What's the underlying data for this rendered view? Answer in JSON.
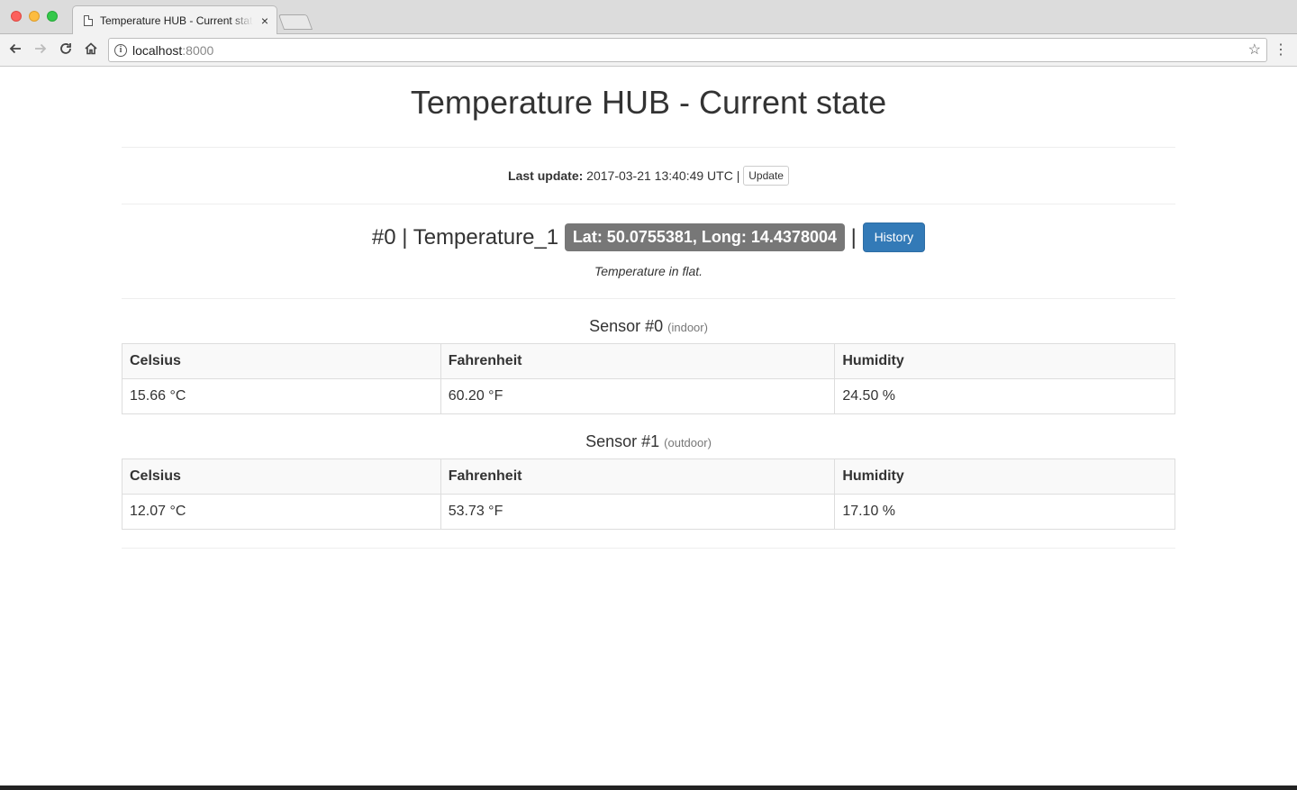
{
  "browser": {
    "tab_title": "Temperature HUB - Current state",
    "tab_close": "×",
    "url_host": "localhost",
    "url_port": ":8000",
    "icons": [
      "back-icon",
      "forward-icon",
      "reload-icon",
      "home-icon",
      "info-icon",
      "star-icon",
      "menu-icon"
    ]
  },
  "page": {
    "title": "Temperature HUB - Current state",
    "last_update_label": "Last update:",
    "last_update_value": "2017-03-21 13:40:49 UTC |",
    "update_button": "Update"
  },
  "device": {
    "heading": "#0 | Temperature_1",
    "location_label": "Lat: 50.0755381, Long: 14.4378004",
    "separator": "|",
    "history_button": "History",
    "description": "Temperature in flat.",
    "colors": {
      "label": "#777777",
      "primary": "#337ab7"
    }
  },
  "sensors": [
    {
      "title": "Sensor #0",
      "location": "(indoor)",
      "headers": [
        "Celsius",
        "Fahrenheit",
        "Humidity"
      ],
      "values": [
        "15.66 °C",
        "60.20 °F",
        "24.50 %"
      ]
    },
    {
      "title": "Sensor #1",
      "location": "(outdoor)",
      "headers": [
        "Celsius",
        "Fahrenheit",
        "Humidity"
      ],
      "values": [
        "12.07 °C",
        "53.73 °F",
        "17.10 %"
      ]
    }
  ]
}
